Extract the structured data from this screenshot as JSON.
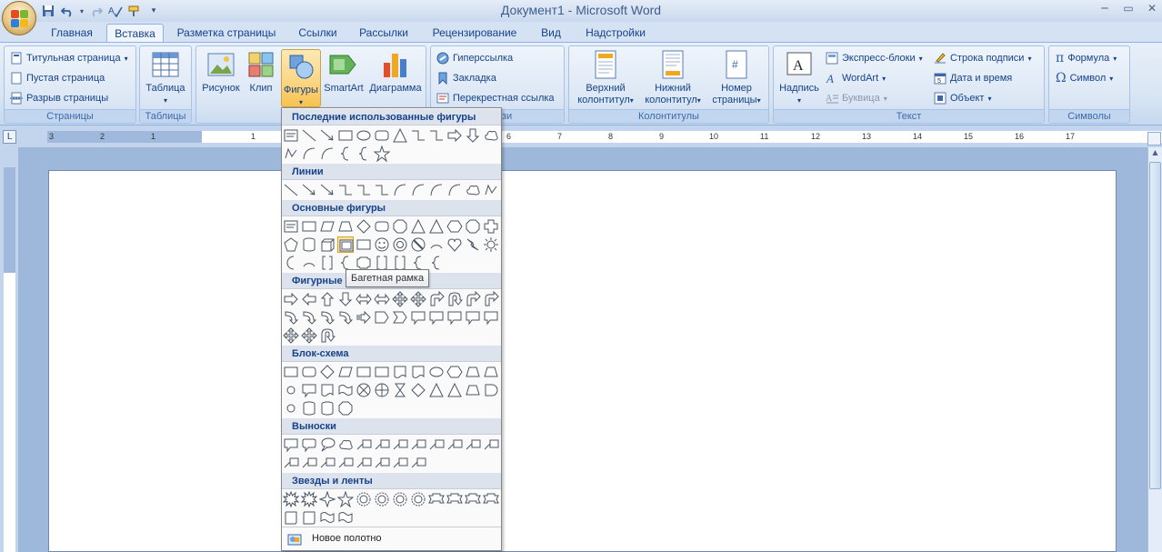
{
  "window": {
    "title": "Документ1 - Microsoft Word",
    "controls": [
      "minimize",
      "restore",
      "close"
    ]
  },
  "quick_access": [
    "save-icon",
    "undo-icon",
    "redo-icon",
    "spelling-icon",
    "format-painter-icon",
    "customize-icon"
  ],
  "tabs": [
    {
      "label": "Главная"
    },
    {
      "label": "Вставка"
    },
    {
      "label": "Разметка страницы"
    },
    {
      "label": "Ссылки"
    },
    {
      "label": "Рассылки"
    },
    {
      "label": "Рецензирование"
    },
    {
      "label": "Вид"
    },
    {
      "label": "Надстройки"
    }
  ],
  "ribbon": {
    "pages": {
      "label": "Страницы",
      "items": [
        "Титульная страница",
        "Пустая страница",
        "Разрыв страницы"
      ]
    },
    "tables": {
      "label": "Таблицы",
      "button": "Таблица"
    },
    "illustrations": {
      "picture": "Рисунок",
      "clip": "Клип",
      "shapes": "Фигуры",
      "smartart": "SmartArt",
      "chart": "Диаграмма"
    },
    "links": {
      "label_tail": "зи",
      "items": [
        "Гиперссылка",
        "Закладка",
        "Перекрестная ссылка"
      ]
    },
    "header_footer": {
      "label": "Колонтитулы",
      "header": [
        "Верхний",
        "колонтитул"
      ],
      "footer": [
        "Нижний",
        "колонтитул"
      ],
      "page_number": [
        "Номер",
        "страницы"
      ]
    },
    "text": {
      "label": "Текст",
      "textbox": "Надпись",
      "items": [
        "Экспресс-блоки",
        "WordArt",
        "Буквица",
        "Строка подписи",
        "Дата и время",
        "Объект"
      ]
    },
    "symbols": {
      "label": "Символы",
      "items": [
        "Формула",
        "Символ"
      ]
    }
  },
  "ruler": {
    "numbers": [
      "3",
      "2",
      "1",
      "1",
      "2",
      "3",
      "4",
      "5",
      "6",
      "7",
      "8",
      "9",
      "10",
      "11",
      "12",
      "13",
      "14",
      "15",
      "16",
      "17"
    ]
  },
  "shapes_menu": {
    "categories": [
      "Последние использованные фигуры",
      "Линии",
      "Основные фигуры",
      "Фигурные",
      "Блок-схема",
      "Выноски",
      "Звезды и ленты"
    ],
    "footer": "Новое полотно",
    "tooltip": "Багетная рамка",
    "colors": {
      "selected_fill": "#fde3a0",
      "selected_border": "#e3a21a",
      "header_bg": "#dde3ec"
    }
  }
}
